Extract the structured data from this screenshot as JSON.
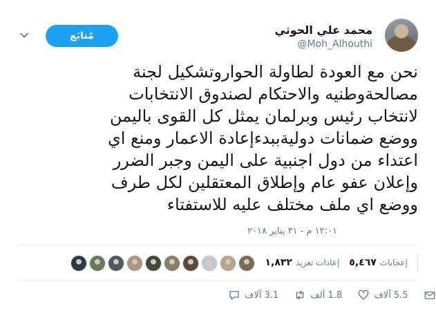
{
  "author": {
    "name": "محمد علي الحوثي",
    "handle": "@Moh_Alhouthi"
  },
  "follow_button": {
    "label": "مُتابَع"
  },
  "tweet": {
    "lines": [
      "نحن مع العودة لطاولة الحواروتشكيل لجنة",
      "مصالحةوطنيه والاحتكام لصندوق الانتخابات",
      "لانتخاب رئيس وبرلمان يمثل كل القوى باليمن",
      "ووضع ضمانات دوليةببدءإعادة الاعمار ومنع اي",
      "اعتداء من دول اجنبية على اليمن وجبر الضرر",
      "وإعلان عفو عام وإطلاق المعتقلين لكل طرف",
      "ووضع اي ملف مختلف عليه للاستفتاء"
    ],
    "timestamp": "١٢:٠١ م - ٣١ يناير ٢٠١٨"
  },
  "stats": {
    "retweets": {
      "count": "١,٨٣٢",
      "label": "إعادات تغريد"
    },
    "likes": {
      "count": "٥,٤٦٧",
      "label": "إعجابات"
    }
  },
  "likers_colors": [
    "#7a6a58",
    "#b7a58a",
    "#c6c9cc",
    "#5a4a3c",
    "#8b7e6a",
    "#3f4a3a",
    "#a89880",
    "#4d5a66",
    "#6b7a5a",
    "#2f3b4a"
  ],
  "actions": {
    "reply": "3.1 آلاف",
    "retweet": "1.8 ألف",
    "like": "5.5 آلاف"
  },
  "colors": {
    "accent": "#1da1f2",
    "muted": "#657786",
    "text": "#14171a"
  }
}
